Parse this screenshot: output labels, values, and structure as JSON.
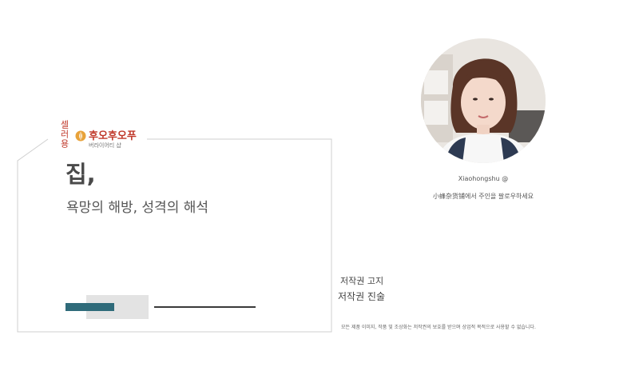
{
  "brand": {
    "vertical_text": "셀러용",
    "name": "후오후오푸",
    "sub": "버라이어티 샵"
  },
  "cover": {
    "title": "집,",
    "subtitle": "욕망의 해방, 성격의 해석"
  },
  "author": {
    "name": "Xiaohongshu @",
    "follow_text": "小蜂杂货铺에서 주인을 팔로우하세요"
  },
  "copyright": {
    "title": "저작권 고지",
    "subtitle": "저작권 진술",
    "note": "모든 제품 이미지, 작품 및 조상화는 저작권의 보호를 받으며 상업적 목적으로 사용할 수 없습니다."
  },
  "colors": {
    "brand_red": "#c0392b",
    "accent_teal": "#2f6b7a",
    "frame_line": "#cfcfcf"
  }
}
